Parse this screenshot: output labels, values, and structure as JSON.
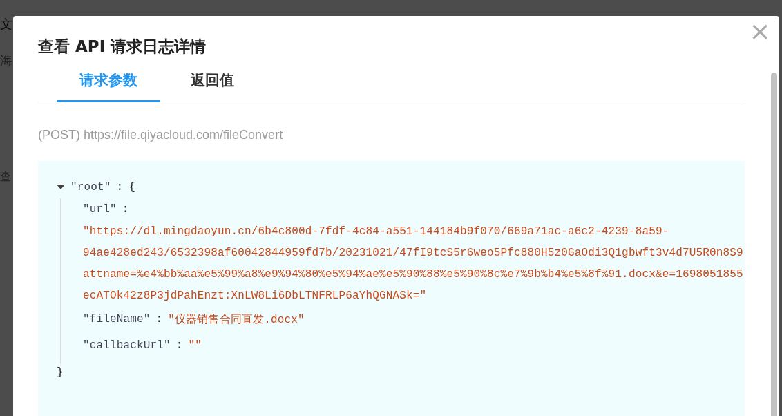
{
  "background_page": {
    "title": "文",
    "subtitle": "海",
    "label": "查"
  },
  "dialog": {
    "title": "查看 API 请求日志详情",
    "close": "×"
  },
  "tabs": [
    {
      "label": "请求参数",
      "selected": true
    },
    {
      "label": "返回值",
      "selected": false
    }
  ],
  "request_line": "(POST) https://file.qiyacloud.com/fileConvert",
  "json_view": {
    "root_key": "\"root\"",
    "colon": ":",
    "expanded": true,
    "open_brace": "{",
    "close_brace": "}",
    "fields": [
      {
        "kind": "block",
        "key": "\"url\"",
        "colon": ":",
        "value_lines": [
          "\"https://dl.mingdaoyun.cn/6b4c800d-7fdf-4c84-a551-144184b9f070/669a71ac-a6c2-4239-8a59-",
          "94ae428ed243/6532398af60042844959fd7b/20231021/47fI9tcS5r6weo5Pfc880H5z0GaOdi3Q1gbwft3v4d7U5R0n8S9",
          "attname=%e4%bb%aa%e5%99%a8%e9%94%80%e5%94%ae%e5%90%88%e5%90%8c%e7%9b%b4%e5%8f%91.docx&e=1698051855",
          "ecATOk42z8P3jdPahEnzt:XnLW8Li6DbLTNFRLP6aYhQGNASk=\""
        ]
      },
      {
        "kind": "inline",
        "key": "\"fileName\"",
        "colon": ":",
        "value_lines": [
          "\"仪器销售合同直发.docx\""
        ]
      },
      {
        "kind": "inline",
        "key": "\"callbackUrl\"",
        "colon": ":",
        "value_lines": [
          "\"\""
        ]
      }
    ]
  }
}
